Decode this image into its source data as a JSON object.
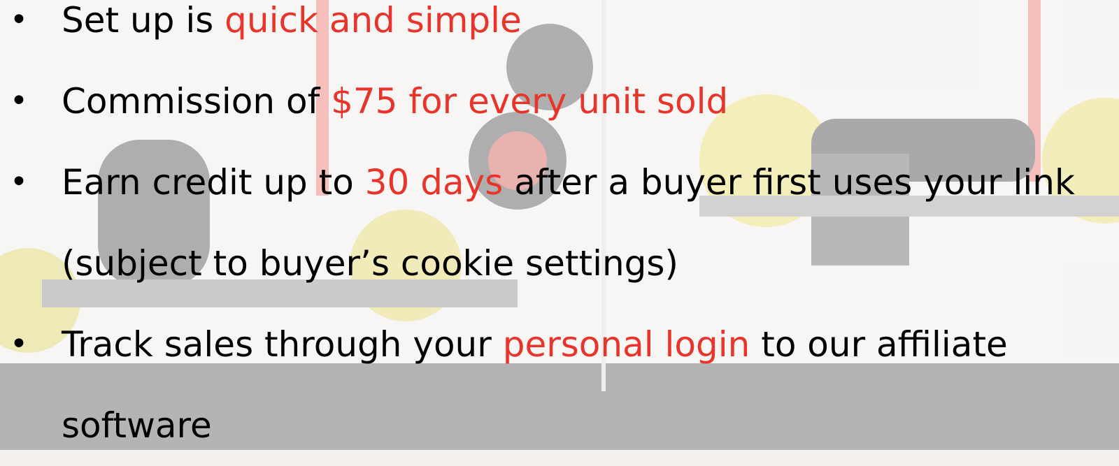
{
  "colors": {
    "text": "#000000",
    "highlight": "#e8342a"
  },
  "bullets": [
    {
      "lines": [
        [
          {
            "text": "Set up is "
          },
          {
            "text": "quick and simple",
            "highlight": true
          }
        ]
      ]
    },
    {
      "lines": [
        [
          {
            "text": "Commission of "
          },
          {
            "text": "$75 for every unit sold",
            "highlight": true
          }
        ]
      ]
    },
    {
      "lines": [
        [
          {
            "text": "Earn credit up to "
          },
          {
            "text": "30 days",
            "highlight": true
          },
          {
            "text": " after a buyer first uses your link"
          }
        ],
        [
          {
            "text": "(subject to buyer’s cookie settings)"
          }
        ]
      ]
    },
    {
      "lines": [
        [
          {
            "text": "Track sales through your "
          },
          {
            "text": "personal login",
            "highlight": true
          },
          {
            "text": " to our affiliate"
          }
        ],
        [
          {
            "text": "software"
          }
        ]
      ]
    }
  ],
  "bullet_glyph": "•"
}
